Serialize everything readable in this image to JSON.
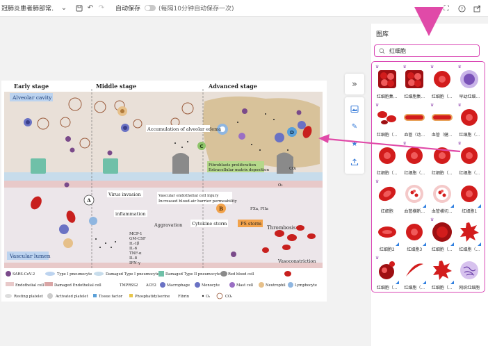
{
  "toolbar": {
    "doc_title": "冠肺炎患者肺部常...",
    "autosave_label": "自动保存",
    "autosave_hint": "(每隔10分钟自动保存一次)"
  },
  "panel": {
    "title": "图库",
    "search_value": "红细胞"
  },
  "figure": {
    "stage_early": "Early stage",
    "stage_middle": "Middle stage",
    "stage_advanced": "Advanced stage",
    "alveolar_cavity": "Alveolar cavity",
    "vascular_lumen": "Vascular lumen",
    "accumulation": "Accumulation of alveolar edema",
    "fibro_1": "Fibroblasts proliferation",
    "fibro_2": "Extracellular matrix deposition",
    "virus_invasion": "Virus invasion",
    "inflammation": "inflammation",
    "vec_1": "Vascular endothelial cell injury",
    "vec_2": "Increased blood-air barrier permeability",
    "aggravation": "Aggravation",
    "cytokine_storm": "Cytokine storm",
    "ps_storm": "PS storm",
    "thrombosis": "Thrombosis",
    "vasoconstriction": "Vasoconstriction",
    "fxa": "FXa, FIIa",
    "co2": "CO₂",
    "o2": "O₂",
    "label_a": "A",
    "label_b": "B",
    "label_c": "C",
    "label_d": "D",
    "cytokines": [
      "MCP-1",
      "GM-CSF",
      "IL-1β",
      "IL-6",
      "TNF-α",
      "IL-8",
      "IFN-γ"
    ],
    "legend": [
      "SARS-CoV-2",
      "Type I pneumocyte",
      "Damaged Type I pneumocyte",
      "Damaged Type II pneumocyte",
      "Red blood cell",
      "Endothelial cell",
      "Damaged Endothelial cell",
      "TMPRSS2",
      "ACE2",
      "Macrophage",
      "Monocyte",
      "Mast cell",
      "Neutrophil",
      "Lymphocyte",
      "Resting platelet",
      "Activated platelet",
      "Tissue factor",
      "Phosphatidylserine",
      "Fibrin",
      "O₂",
      "CO₂"
    ]
  },
  "gallery": [
    {
      "label": "红细胞集...",
      "vip": true,
      "corner": false,
      "kind": "cluster"
    },
    {
      "label": "红细胞集...",
      "vip": true,
      "corner": false,
      "kind": "cluster"
    },
    {
      "label": "红细胞（...",
      "vip": true,
      "corner": false,
      "kind": "disc"
    },
    {
      "label": "早幼红细...",
      "vip": true,
      "corner": false,
      "kind": "purple"
    },
    {
      "label": "红细胞（...",
      "vip": true,
      "corner": false,
      "kind": "multi"
    },
    {
      "label": "血管（动...",
      "vip": false,
      "corner": false,
      "kind": "vessel"
    },
    {
      "label": "血管（健...",
      "vip": true,
      "corner": false,
      "kind": "vessel"
    },
    {
      "label": "红细胞（...",
      "vip": true,
      "corner": false,
      "kind": "disc"
    },
    {
      "label": "红细胞（...",
      "vip": false,
      "corner": false,
      "kind": "disc"
    },
    {
      "label": "红细胞（...",
      "vip": true,
      "corner": false,
      "kind": "disc"
    },
    {
      "label": "红细胞（...",
      "vip": false,
      "corner": false,
      "kind": "disc"
    },
    {
      "label": "红细胞（...",
      "vip": true,
      "corner": false,
      "kind": "disc"
    },
    {
      "label": "红细胞",
      "vip": true,
      "corner": false,
      "kind": "tilt"
    },
    {
      "label": "血管横断...",
      "vip": false,
      "corner": true,
      "kind": "ring"
    },
    {
      "label": "血管横切...",
      "vip": false,
      "corner": true,
      "kind": "ring"
    },
    {
      "label": "红细胞1",
      "vip": false,
      "corner": true,
      "kind": "disc"
    },
    {
      "label": "红细胞2",
      "vip": false,
      "corner": true,
      "kind": "flat"
    },
    {
      "label": "红细胞3",
      "vip": false,
      "corner": true,
      "kind": "disc"
    },
    {
      "label": "红细胞（...",
      "vip": true,
      "corner": true,
      "kind": "big"
    },
    {
      "label": "红细胞（...",
      "vip": false,
      "corner": true,
      "kind": "spiky"
    },
    {
      "label": "红细胞（...",
      "vip": true,
      "corner": true,
      "kind": "bomb"
    },
    {
      "label": "红细胞（...",
      "vip": false,
      "corner": true,
      "kind": "sickle"
    },
    {
      "label": "红细胞（...",
      "vip": false,
      "corner": true,
      "kind": "spiky"
    },
    {
      "label": "网织红细胞",
      "vip": false,
      "corner": false,
      "kind": "reticulo"
    }
  ]
}
